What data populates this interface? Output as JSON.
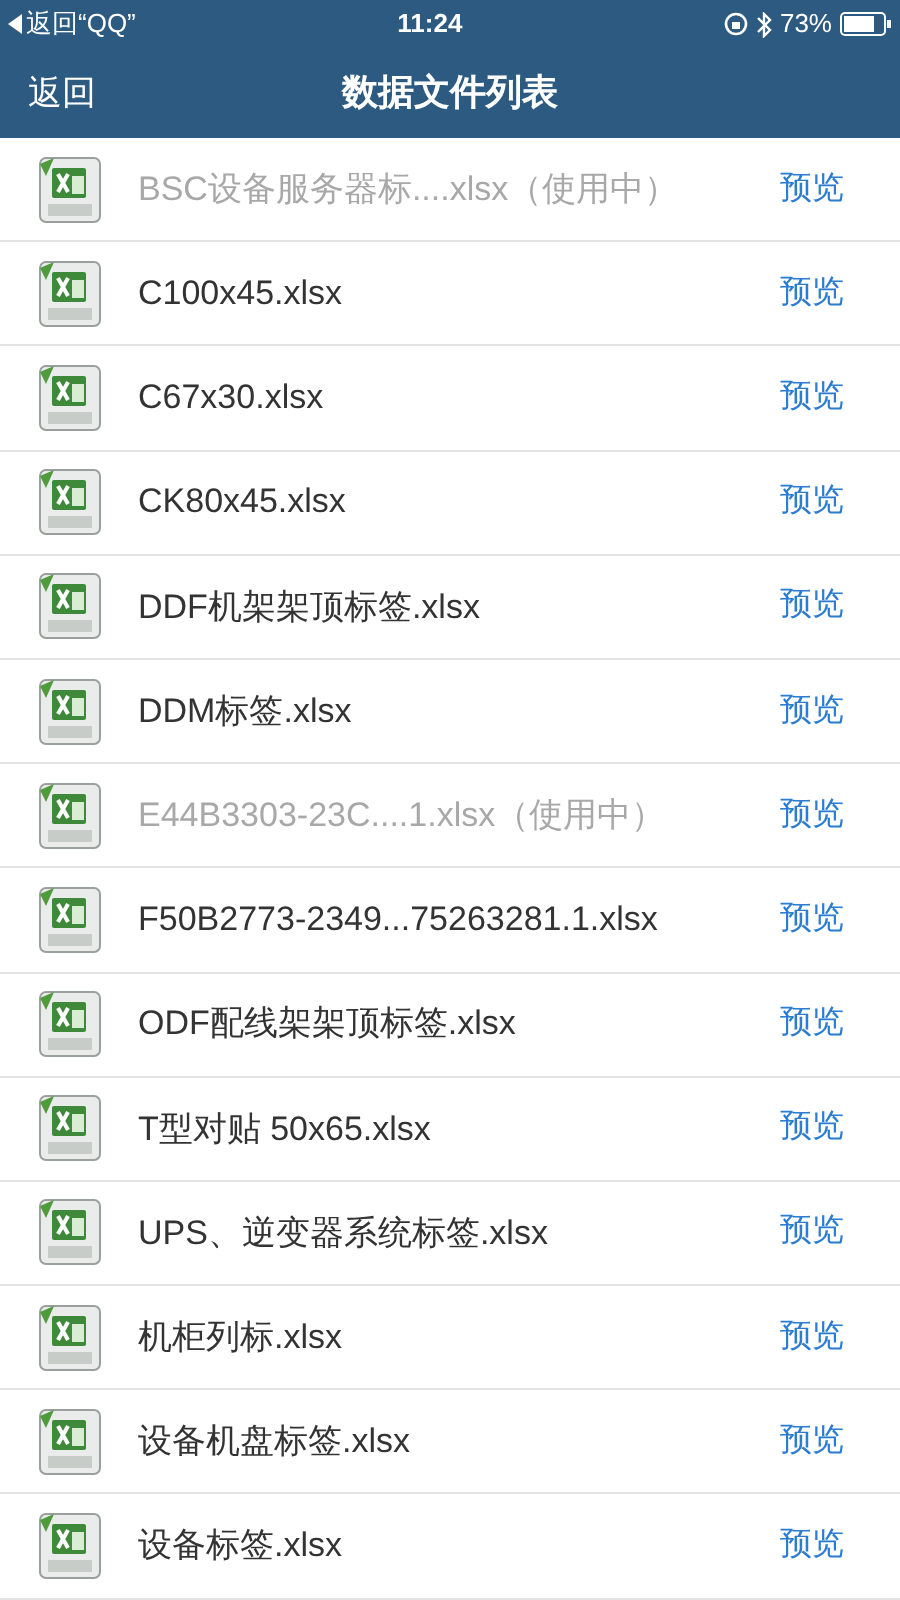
{
  "status_bar": {
    "back_label": "返回“QQ”",
    "time": "11:24",
    "battery": "73%"
  },
  "nav": {
    "back": "返回",
    "title": "数据文件列表"
  },
  "files": [
    {
      "name": "BSC设备服务器标....xlsx（使用中）",
      "disabled": true,
      "action": "预览"
    },
    {
      "name": "C100x45.xlsx",
      "disabled": false,
      "action": "预览"
    },
    {
      "name": "C67x30.xlsx",
      "disabled": false,
      "action": "预览"
    },
    {
      "name": "CK80x45.xlsx",
      "disabled": false,
      "action": "预览"
    },
    {
      "name": "DDF机架架顶标签.xlsx",
      "disabled": false,
      "action": "预览"
    },
    {
      "name": "DDM标签.xlsx",
      "disabled": false,
      "action": "预览"
    },
    {
      "name": "E44B3303-23C....1.xlsx（使用中）",
      "disabled": true,
      "action": "预览"
    },
    {
      "name": "F50B2773-2349...75263281.1.xlsx",
      "disabled": false,
      "action": "预览"
    },
    {
      "name": "ODF配线架架顶标签.xlsx",
      "disabled": false,
      "action": "预览"
    },
    {
      "name": "T型对贴 50x65.xlsx",
      "disabled": false,
      "action": "预览"
    },
    {
      "name": "UPS、逆变器系统标签.xlsx",
      "disabled": false,
      "action": "预览"
    },
    {
      "name": "机柜列标.xlsx",
      "disabled": false,
      "action": "预览"
    },
    {
      "name": "设备机盘标签.xlsx",
      "disabled": false,
      "action": "预览"
    },
    {
      "name": "设备标签.xlsx",
      "disabled": false,
      "action": "预览"
    }
  ]
}
